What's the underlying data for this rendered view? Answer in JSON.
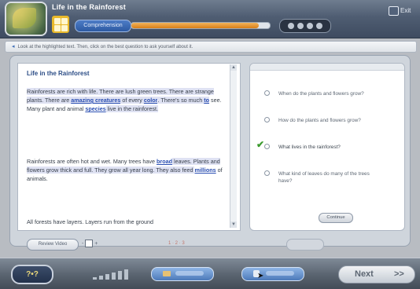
{
  "app": {
    "title": "Life in the Rainforest",
    "mode": "Comprehension",
    "progress_percent": 92,
    "exit_label": "Exit"
  },
  "instruction": "Look at the highlighted text. Then, click on the best question to ask yourself about it.",
  "reading": {
    "title": "Life in the Rainforest",
    "para1": {
      "t1": "Rainforests are rich with life. There are lush green trees. There are strange plants. There are ",
      "l1": "amazing creatures",
      "t2": " of every ",
      "l2": "color",
      "t3": ". There's so much ",
      "l3": "to",
      "t4": " see. Many plant and animal ",
      "l4": "species",
      "t5": " live in the rainforest."
    },
    "para2": {
      "t1": "Rainforests are often hot and wet. Many trees have ",
      "l1": "broad",
      "t2": " leaves. Plants and flowers grow thick and full. They grow all year long. They also feed ",
      "l2": "millions",
      "t3": " of animals."
    },
    "para3": "All forests have layers. Layers run from the ground",
    "scroll_up": "▲",
    "scroll_down": "▼"
  },
  "questions": [
    {
      "text": "When do the plants and flowers grow?",
      "selected": false
    },
    {
      "text": "How do the plants and flowers grow?",
      "selected": false
    },
    {
      "text": "What lives in the rainforest?",
      "selected": true
    },
    {
      "text": "What kind of leaves do many of the trees have?",
      "selected": false
    }
  ],
  "check_mark": "✔",
  "continue_label": "Continue",
  "toolbar": {
    "review_label": "Review Video",
    "font_dash_left": "-",
    "font_dash_right": "+",
    "page_text": "1 · 2 · 3"
  },
  "bottom": {
    "help_label": "?•?",
    "next_label": "Next",
    "next_arrow": ">>"
  }
}
